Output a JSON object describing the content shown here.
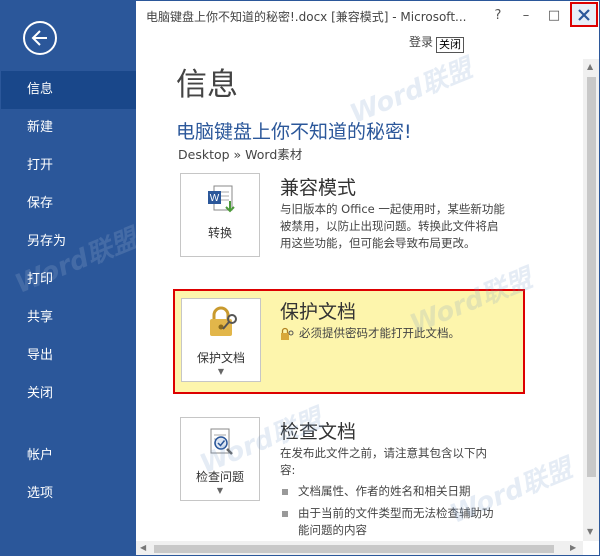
{
  "window": {
    "title": "电脑键盘上你不知道的秘密!.docx [兼容模式] - Microsoft...",
    "help_label": "?",
    "minimize_label": "–",
    "maximize_label": "□",
    "login_label": "登录",
    "close_tooltip": "关闭"
  },
  "sidebar": {
    "items": [
      {
        "label": "信息"
      },
      {
        "label": "新建"
      },
      {
        "label": "打开"
      },
      {
        "label": "保存"
      },
      {
        "label": "另存为"
      },
      {
        "label": "打印"
      },
      {
        "label": "共享"
      },
      {
        "label": "导出"
      },
      {
        "label": "关闭"
      },
      {
        "label": "帐户"
      },
      {
        "label": "选项"
      }
    ]
  },
  "main": {
    "page_title": "信息",
    "doc_title": "电脑键盘上你不知道的秘密!",
    "breadcrumb": "Desktop » Word素材",
    "compat": {
      "button_label": "转换",
      "heading": "兼容模式",
      "lines": [
        "与旧版本的 Office 一起使用时，某些新功能",
        "被禁用，以防止出现问题。转换此文件将启",
        "用这些功能，但可能会导致布局更改。"
      ]
    },
    "protect": {
      "button_label": "保护文档",
      "heading": "保护文档",
      "text": "必须提供密码才能打开此文档。"
    },
    "inspect": {
      "button_label": "检查问题",
      "heading": "检查文档",
      "lines": [
        "在发布此文件之前，请注意其包含以下内",
        "容:"
      ],
      "bullets": [
        "文档属性、作者的姓名和相关日期",
        "由于当前的文件类型而无法检查辅助功",
        "能问题的内容"
      ]
    }
  },
  "watermark": {
    "text": "Word联盟"
  },
  "colors": {
    "accent": "#2b579a",
    "highlight": "#fdf5ac",
    "alert": "#dd0000"
  }
}
